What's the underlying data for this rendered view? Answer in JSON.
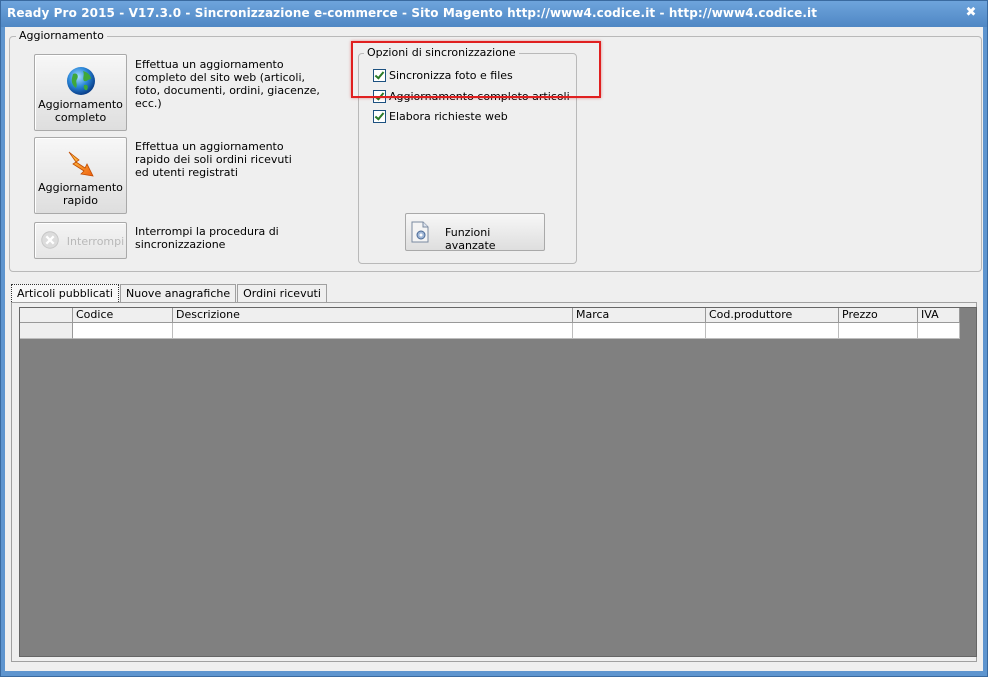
{
  "window": {
    "title": "Ready Pro 2015 - V17.3.0 - Sincronizzazione e-commerce - Sito Magento http://www4.codice.it - http://www4.codice.it",
    "close_glyph": "✖"
  },
  "aggiornamento": {
    "group_title": "Aggiornamento",
    "buttons": [
      {
        "label": "Aggiornamento completo",
        "icon": "globe-icon",
        "description": "Effettua un aggiornamento completo del sito web (articoli, foto, documenti, ordini, giacenze, ecc.)"
      },
      {
        "label": "Aggiornamento rapido",
        "icon": "lightning-arrow-icon",
        "description": "Effettua un aggiornamento rapido dei soli ordini ricevuti ed utenti registrati"
      },
      {
        "label": "Interrompi",
        "icon": "stop-gear-icon",
        "description": "Interrompi la procedura di sincronizzazione"
      }
    ]
  },
  "opzioni": {
    "group_title": "Opzioni di sincronizzazione",
    "checkboxes": [
      {
        "label": "Sincronizza foto e files",
        "checked": true
      },
      {
        "label": "Aggiornamento completo articoli",
        "checked": true
      },
      {
        "label": "Elabora richieste web",
        "checked": true
      }
    ],
    "advanced_button": "Funzioni avanzate"
  },
  "tabs": [
    "Articoli pubblicati",
    "Nuove anagrafiche",
    "Ordini ricevuti"
  ],
  "grid": {
    "columns": [
      "Codice",
      "Descrizione",
      "Marca",
      "Cod.produttore",
      "Prezzo",
      "IVA"
    ]
  },
  "colors": {
    "titlebar": "#5e95cf",
    "highlight": "#e02020",
    "grid_background": "#808080"
  }
}
